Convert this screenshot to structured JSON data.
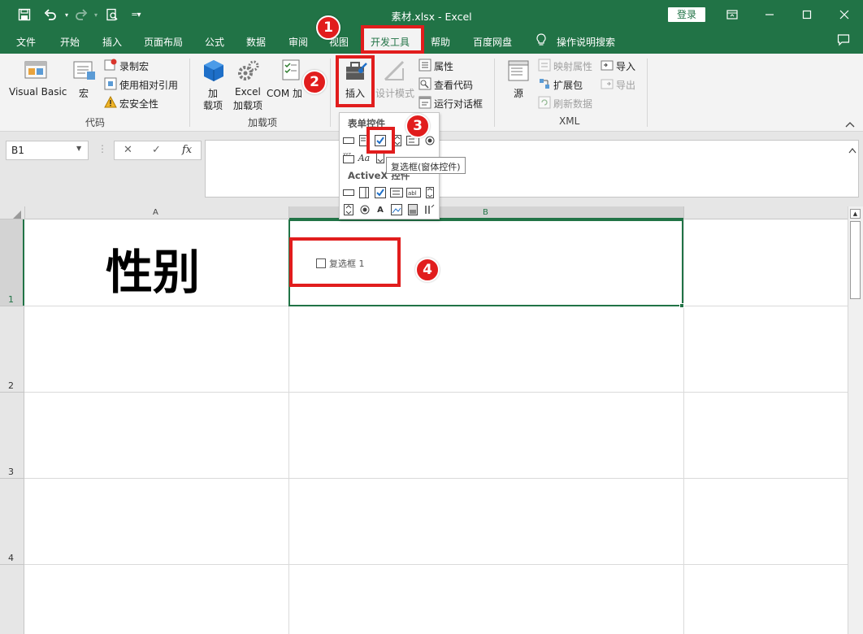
{
  "window": {
    "title": "素材.xlsx  -  Excel",
    "login_label": "登录"
  },
  "quick_access": {
    "icons": [
      "save-icon",
      "undo-icon",
      "redo-icon",
      "print-preview-icon",
      "customize-icon"
    ]
  },
  "tabs": [
    {
      "label": "文件"
    },
    {
      "label": "开始"
    },
    {
      "label": "插入"
    },
    {
      "label": "页面布局"
    },
    {
      "label": "公式"
    },
    {
      "label": "数据"
    },
    {
      "label": "审阅"
    },
    {
      "label": "视图"
    },
    {
      "label": "开发工具",
      "active": true
    },
    {
      "label": "帮助"
    },
    {
      "label": "百度网盘"
    },
    {
      "label": "操作说明搜索"
    }
  ],
  "ribbon": {
    "code": {
      "label": "代码",
      "visual_basic": "Visual Basic",
      "macros": "宏",
      "record_macro": "录制宏",
      "relative_ref": "使用相对引用",
      "macro_security": "宏安全性"
    },
    "addins": {
      "label": "加载项",
      "addins_line1": "加",
      "addins_line2": "载项",
      "excel_addins_line1": "Excel",
      "excel_addins_line2": "加载项",
      "com_addins": "COM 加"
    },
    "controls": {
      "insert": "插入",
      "design_mode": "设计模式",
      "properties": "属性",
      "view_code": "查看代码",
      "run_dialog": "运行对话框"
    },
    "xml": {
      "label": "XML",
      "source": "源",
      "map_properties": "映射属性",
      "expansion_packs": "扩展包",
      "refresh_data": "刷新数据",
      "import": "导入",
      "export": "导出"
    }
  },
  "formula_bar": {
    "name_box": "B1",
    "fx_label": "fx",
    "formula": ""
  },
  "palette": {
    "form_controls_label": "表单控件",
    "activex_label": "ActiveX 控件",
    "tooltip": "复选框(窗体控件)"
  },
  "grid": {
    "columns": [
      "A",
      "B"
    ],
    "rows": [
      "1",
      "2",
      "3",
      "4"
    ],
    "cell_A1": "性别",
    "checkbox_label": "复选框 1"
  },
  "annotations": {
    "step1": "1",
    "step2": "2",
    "step3": "3",
    "step4": "4"
  },
  "colors": {
    "excel_green": "#217346",
    "annotation_red": "#e11d1d"
  }
}
